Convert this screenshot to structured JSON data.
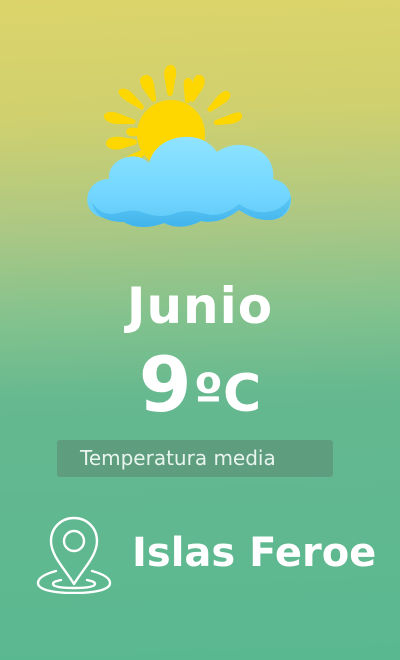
{
  "weather": {
    "icon": "sun-behind-cloud-icon",
    "month": "Junio",
    "temperature_value": "9",
    "temperature_unit": "ºC",
    "caption": "Temperatura media",
    "location": "Islas Feroe",
    "location_icon": "map-pin-icon"
  },
  "colors": {
    "sun": "#FFD700",
    "cloud": "#72D6FF",
    "text": "#FFFFFF",
    "background_top": "#DCD46A",
    "background_bottom": "#5AB891"
  }
}
